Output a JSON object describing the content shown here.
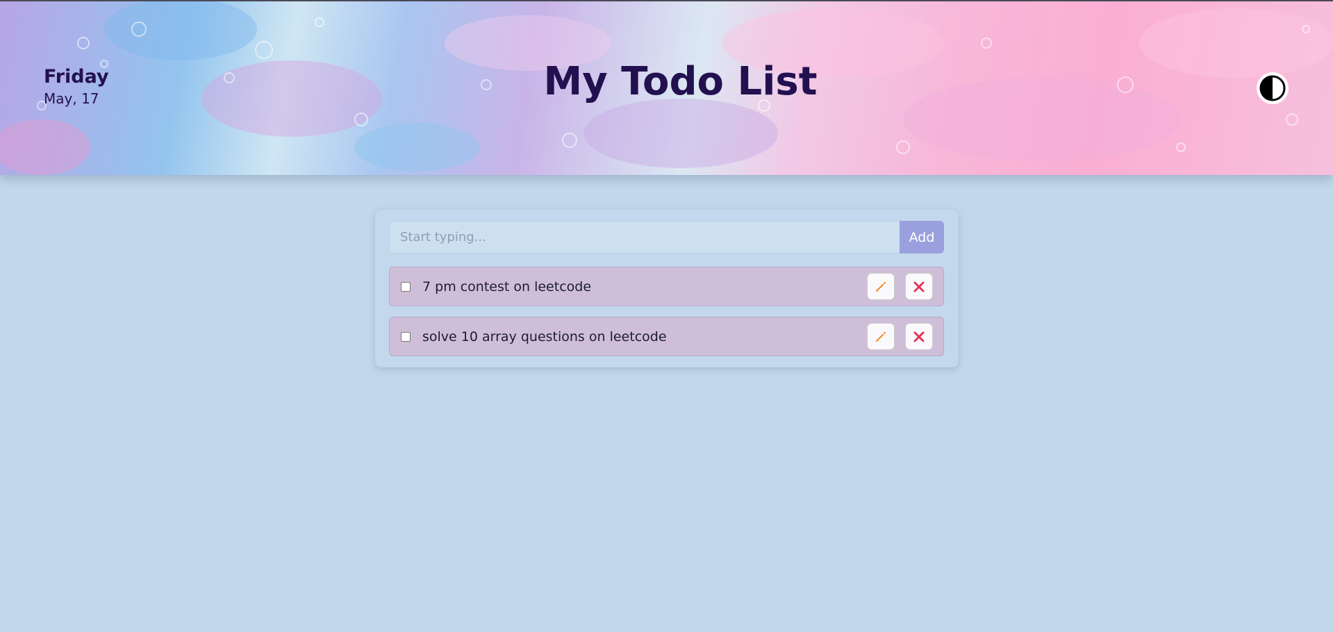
{
  "header": {
    "day": "Friday",
    "date": "May, 17",
    "title": "My Todo List",
    "theme_toggle_icon": "contrast-icon"
  },
  "input": {
    "placeholder": "Start typing...",
    "value": "",
    "add_label": "Add"
  },
  "todos": [
    {
      "text": "7 pm contest on leetcode",
      "checked": false,
      "edit_icon": "pencil-icon",
      "delete_icon": "close-icon"
    },
    {
      "text": "solve 10 array questions on leetcode",
      "checked": false,
      "edit_icon": "pencil-icon",
      "delete_icon": "close-icon"
    }
  ],
  "colors": {
    "background": "#c1d7eb",
    "title": "#22104f",
    "add_button": "#9aa0dd",
    "todo_item": "#cfbed8",
    "edit_icon": "#f28a2e",
    "delete_icon": "#e8325a"
  }
}
